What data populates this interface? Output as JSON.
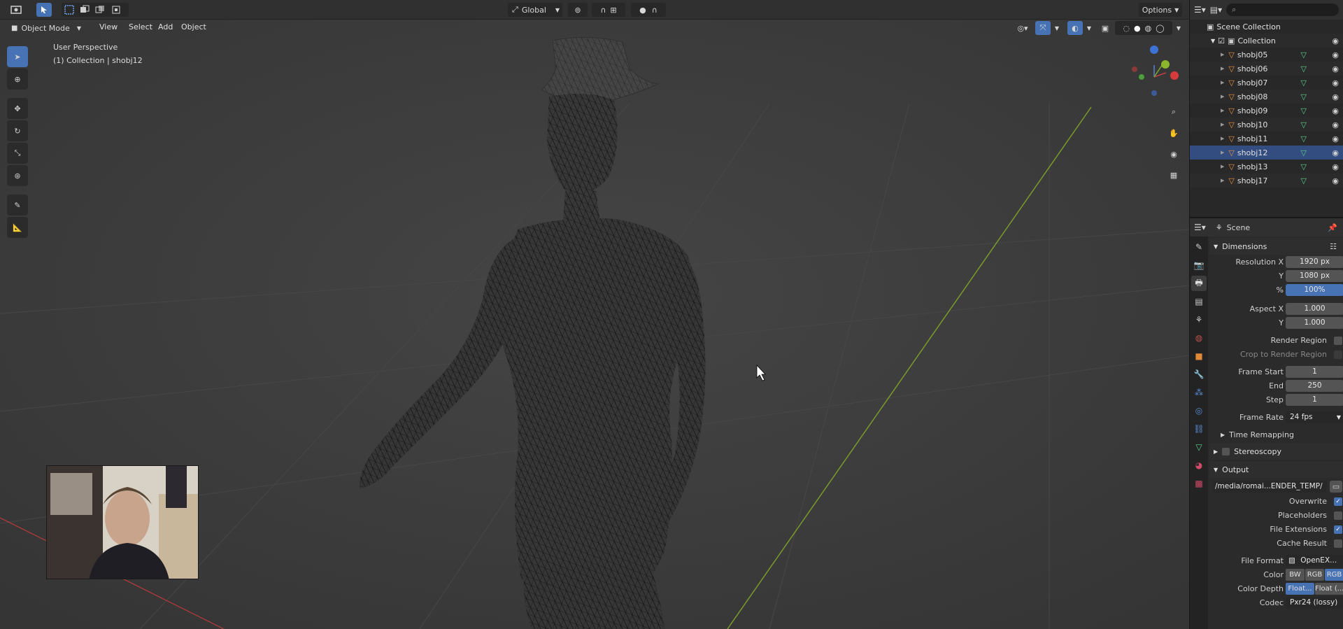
{
  "header": {
    "editor_icon": "viewport-editor-icon",
    "transform_orientation": "Global",
    "options_label": "Options"
  },
  "viewport_header": {
    "mode": "Object Mode",
    "menus": [
      "View",
      "Select",
      "Add",
      "Object"
    ]
  },
  "viewport": {
    "perspective_label": "User Perspective",
    "collection_label": "(1) Collection | shobj12"
  },
  "outliner": {
    "search_placeholder": "",
    "root": "Scene Collection",
    "collection": "Collection",
    "objects": [
      "shobj05",
      "shobj06",
      "shobj07",
      "shobj08",
      "shobj09",
      "shobj10",
      "shobj11",
      "shobj12",
      "shobj13",
      "shobj17"
    ],
    "active_object": "shobj12"
  },
  "properties": {
    "context": "Scene",
    "dimensions": {
      "title": "Dimensions",
      "resolution_x_label": "Resolution X",
      "resolution_x": "1920 px",
      "resolution_y_label": "Y",
      "resolution_y": "1080 px",
      "percent_label": "%",
      "percent": "100%",
      "aspect_x_label": "Aspect X",
      "aspect_x": "1.000",
      "aspect_y_label": "Y",
      "aspect_y": "1.000",
      "render_region": "Render Region",
      "crop_region": "Crop to Render Region",
      "frame_start_label": "Frame Start",
      "frame_start": "1",
      "frame_end_label": "End",
      "frame_end": "250",
      "frame_step_label": "Step",
      "frame_step": "1",
      "frame_rate_label": "Frame Rate",
      "frame_rate": "24 fps",
      "time_remapping": "Time Remapping"
    },
    "stereoscopy": "Stereoscopy",
    "output": {
      "title": "Output",
      "path": "/media/romai...ENDER_TEMP/",
      "overwrite": "Overwrite",
      "placeholders": "Placeholders",
      "file_extensions": "File Extensions",
      "cache_result": "Cache Result",
      "file_format_label": "File Format",
      "file_format": "OpenEX...",
      "color_label": "Color",
      "color_options": [
        "BW",
        "RGB",
        "RGB"
      ],
      "color_depth_label": "Color Depth",
      "color_depth_options": [
        "Float...",
        "Float (..."
      ],
      "codec_label": "Codec",
      "codec": "Pxr24 (lossy)"
    }
  },
  "colors": {
    "accent": "#4772b3",
    "viewport_bg": "#3d3d3d",
    "panel_bg": "#2b2b2b",
    "x_axis": "#a33a3a",
    "y_axis": "#7a9a2a"
  }
}
